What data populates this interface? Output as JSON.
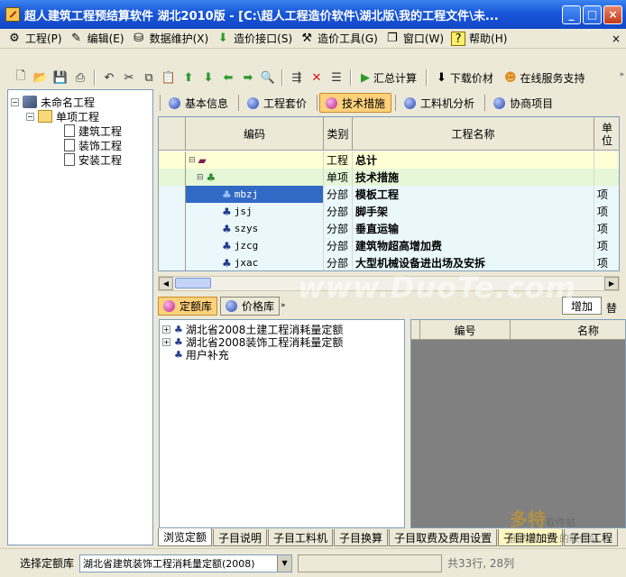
{
  "window": {
    "title": "超人建筑工程预结算软件 湖北2010版 - [C:\\超人工程造价软件\\湖北版\\我的工程文件\\未..."
  },
  "menu": {
    "items": [
      {
        "label": "工程(P)",
        "icon": "project-icon"
      },
      {
        "label": "编辑(E)",
        "icon": "edit-icon"
      },
      {
        "label": "数据维护(X)",
        "icon": "database-icon"
      },
      {
        "label": "造价接口(S)",
        "icon": "interface-icon"
      },
      {
        "label": "造价工具(G)",
        "icon": "tools-icon"
      },
      {
        "label": "窗口(W)",
        "icon": "window-icon"
      },
      {
        "label": "帮助(H)",
        "icon": "help-icon"
      }
    ]
  },
  "toolbar": {
    "summary_label": "汇总计算",
    "download_label": "下载价材",
    "online_label": "在线服务支持"
  },
  "tree": {
    "root": "未命名工程",
    "unit": "单项工程",
    "children": [
      "建筑工程",
      "装饰工程",
      "安装工程"
    ]
  },
  "subtabs": [
    {
      "label": "基本信息",
      "active": false
    },
    {
      "label": "工程套价",
      "active": false
    },
    {
      "label": "技术措施",
      "active": true
    },
    {
      "label": "工料机分析",
      "active": false
    },
    {
      "label": "协商项目",
      "active": false
    }
  ],
  "grid": {
    "headers": {
      "code": "编码",
      "type": "类别",
      "name": "工程名称",
      "unit": "单位"
    },
    "rows": [
      {
        "code": "",
        "type": "工程",
        "name": "总计",
        "unit": "",
        "kind": "total"
      },
      {
        "code": "",
        "type": "单项",
        "name": "技术措施",
        "unit": "",
        "kind": "unit"
      },
      {
        "code": "mbzj",
        "type": "分部",
        "name": "模板工程",
        "unit": "项",
        "kind": "part",
        "selected": true
      },
      {
        "code": "jsj",
        "type": "分部",
        "name": "脚手架",
        "unit": "项",
        "kind": "part"
      },
      {
        "code": "szys",
        "type": "分部",
        "name": "垂直运输",
        "unit": "项",
        "kind": "part"
      },
      {
        "code": "jzcg",
        "type": "分部",
        "name": "建筑物超高增加费",
        "unit": "项",
        "kind": "part"
      },
      {
        "code": "jxac",
        "type": "分部",
        "name": "大型机械设备进出场及安拆",
        "unit": "项",
        "kind": "part"
      }
    ]
  },
  "libtabs": {
    "quota": "定额库",
    "price": "价格库",
    "add": "增加",
    "extra": "替"
  },
  "rule_tree": {
    "items": [
      "湖北省2008土建工程消耗量定额",
      "湖北省2008装饰工程消耗量定额",
      "用户补充"
    ]
  },
  "detail_list": {
    "headers": {
      "number": "编号",
      "name": "名称"
    }
  },
  "bottomtabs": [
    "浏览定额",
    "子目说明",
    "子目工料机",
    "子目换算",
    "子目取费及费用设置",
    "子目增加费",
    "子目工程"
  ],
  "status": {
    "label": "选择定额库",
    "selected": "湖北省建筑装饰工程消耗量定额(2008)",
    "count": "共33行, 28列"
  },
  "watermark": {
    "site": "www.DuoTe.com",
    "brand": "多特",
    "brand_sub": "软件站",
    "slogan": "国内最安全的软件站"
  }
}
